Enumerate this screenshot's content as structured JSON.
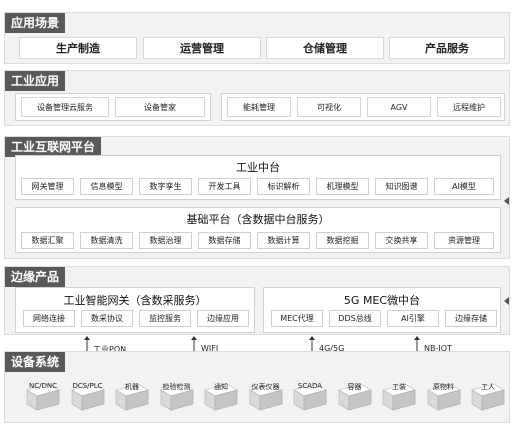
{
  "scenes": {
    "title": "应用场景",
    "items": [
      "生产制造",
      "运营管理",
      "仓储管理",
      "产品服务"
    ]
  },
  "industrial_apps": {
    "title": "工业应用",
    "left": [
      "设备管理云服务",
      "设备管家"
    ],
    "right": [
      "能耗管理",
      "可视化",
      "AGV",
      "远程维护"
    ]
  },
  "platform": {
    "title": "工业互联网平台",
    "middle": {
      "title": "工业中台",
      "items": [
        "网关管理",
        "信息模型",
        "数字孪生",
        "开发工具",
        "标识解析",
        "机理模型",
        "知识图谱",
        "AI模型"
      ]
    },
    "base": {
      "title": "基础平台（含数据中台服务）",
      "items": [
        "数据汇聚",
        "数据清洗",
        "数据治理",
        "数据存储",
        "数据计算",
        "数据挖掘",
        "交换共享",
        "资源管理"
      ]
    }
  },
  "edge": {
    "title": "边缘产品",
    "gateway": {
      "title": "工业智能网关（含数采服务）",
      "items": [
        "网络连接",
        "数采协议",
        "监控服务",
        "边缘应用"
      ]
    },
    "mec": {
      "title": "5G MEC微中台",
      "items": [
        "MEC代理",
        "DDS总线",
        "AI引擎",
        "边缘存储"
      ]
    }
  },
  "links": [
    "工业PON",
    "WIFI",
    "4G/5G",
    "NB-IOT"
  ],
  "devices": {
    "title": "设备系统",
    "items": [
      "NC/DNC",
      "DCS/PLC",
      "机器",
      "检验检测",
      "通知",
      "仪表仪器",
      "SCADA",
      "容器",
      "工装",
      "原物料",
      "工人"
    ]
  }
}
